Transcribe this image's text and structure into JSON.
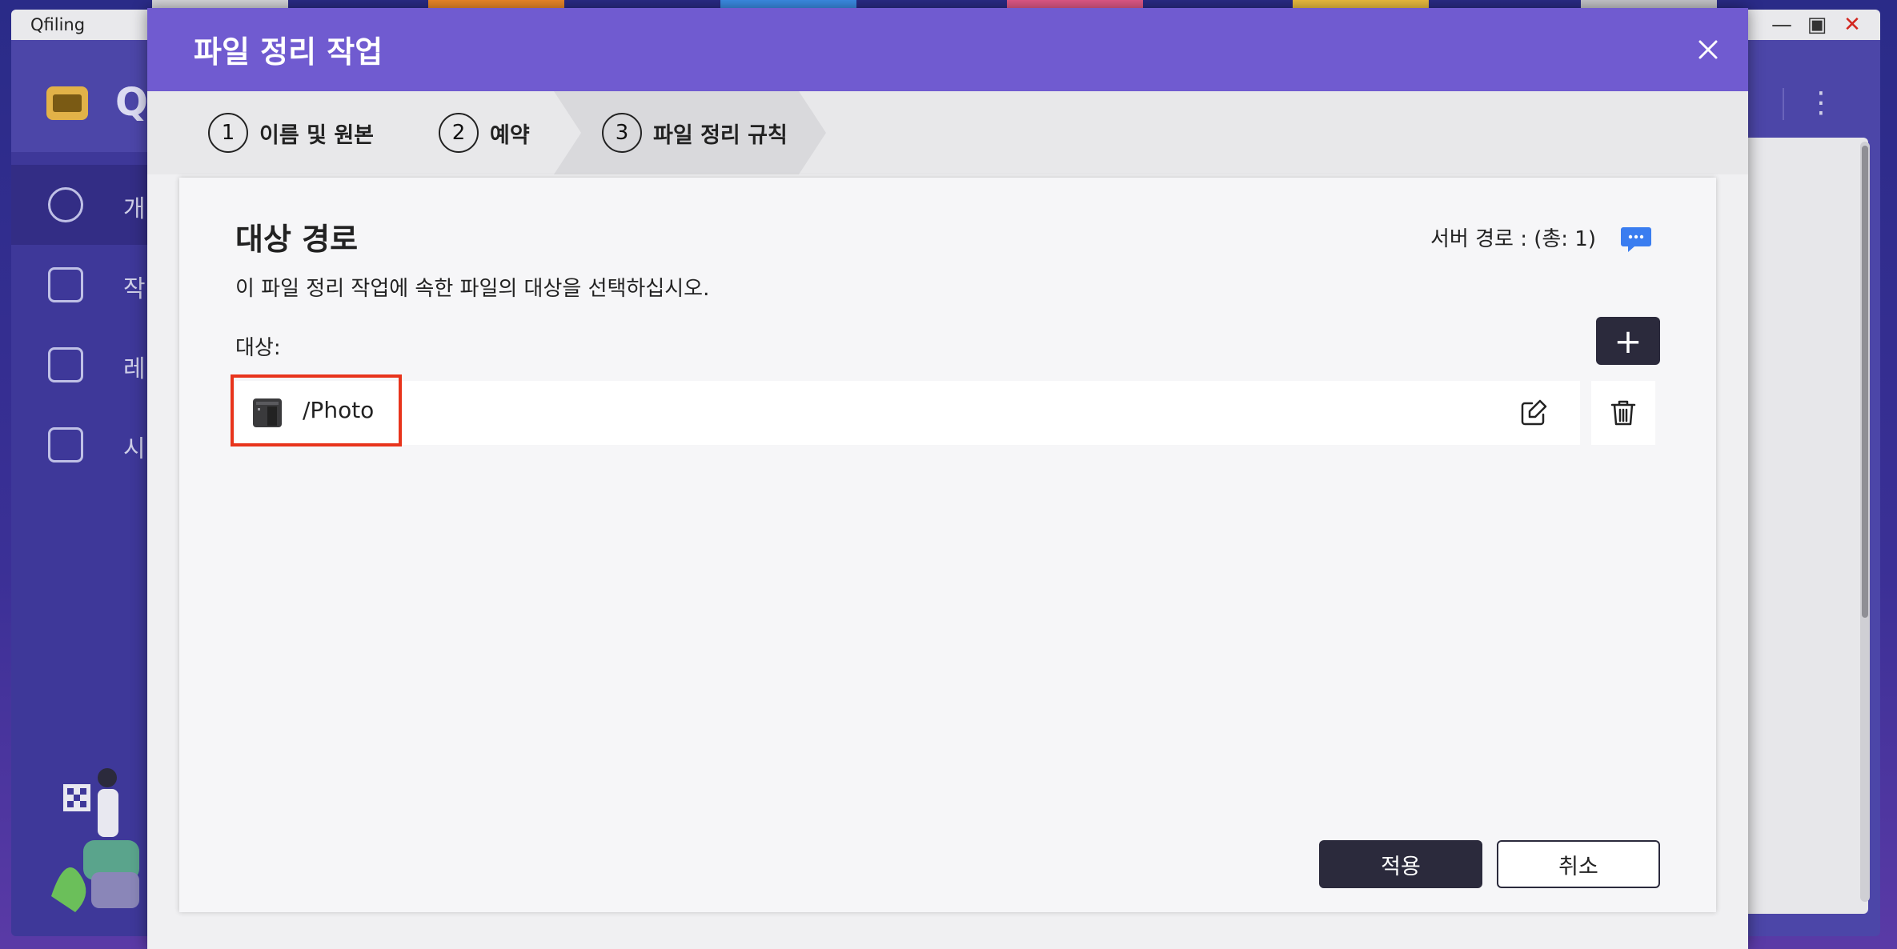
{
  "app": {
    "window_title": "Qfiling",
    "name_initial": "Q",
    "sidebar": [
      {
        "label": "개",
        "icon": "dashboard-icon"
      },
      {
        "label": "작",
        "icon": "tasks-icon"
      },
      {
        "label": "레",
        "icon": "bookmark-icon"
      },
      {
        "label": "시",
        "icon": "clipboard-icon"
      }
    ]
  },
  "modal": {
    "title": "파일 정리 작업",
    "steps": [
      {
        "num": "1",
        "label": "이름 및 원본"
      },
      {
        "num": "2",
        "label": "예약"
      },
      {
        "num": "3",
        "label": "파일 정리 규칙"
      }
    ],
    "active_step": 3,
    "section_title": "대상 경로",
    "section_desc": "이 파일 정리 작업에 속한 파일의 대상을 선택하십시오.",
    "server_path": "서버 경로 : (총: 1)",
    "target_label": "대상:",
    "add_label": "+",
    "targets": [
      {
        "path": "/Photo",
        "icon": "nas-folder-icon"
      }
    ],
    "apply_label": "적용",
    "cancel_label": "취소"
  },
  "colors": {
    "modal_header": "#705bd0",
    "dark_button": "#2b2a3c",
    "highlight": "#e8341c",
    "chat_icon": "#3a7df0"
  }
}
